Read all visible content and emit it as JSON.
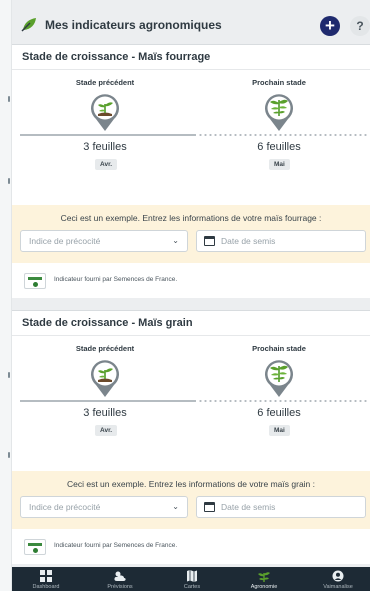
{
  "header": {
    "title": "Mes indicateurs agronomiques",
    "add_symbol": "+",
    "help_symbol": "?"
  },
  "colors": {
    "brand_green": "#5aa02c",
    "navy": "#1f2a6e",
    "example_band": "#fdf3dc",
    "nav_bg": "#1d2a35"
  },
  "cards": [
    {
      "title": "Stade de croissance - Maïs fourrage",
      "previous_label": "Stade précédent",
      "next_label": "Prochain stade",
      "previous_leaves": "3 feuilles",
      "next_leaves": "6 feuilles",
      "previous_month": "Avr.",
      "next_month": "Mai",
      "example_text": "Ceci est un exemple. Entrez les informations de votre maïs fourrage :",
      "precocity_placeholder": "Indice de précocité",
      "sowing_placeholder": "Date de semis",
      "provider_text": "Indicateur fourni par Semences de France."
    },
    {
      "title": "Stade de croissance - Maïs grain",
      "previous_label": "Stade précédent",
      "next_label": "Prochain stade",
      "previous_leaves": "3 feuilles",
      "next_leaves": "6 feuilles",
      "previous_month": "Avr.",
      "next_month": "Mai",
      "example_text": "Ceci est un exemple. Entrez les informations de votre maïs grain :",
      "precocity_placeholder": "Indice de précocité",
      "sowing_placeholder": "Date de semis",
      "provider_text": "Indicateur fourni par Semences de France."
    }
  ],
  "icons": {
    "brand": "leaf-icon",
    "stage": "corn-sprout-icon",
    "dropdown": "chevron-down-icon",
    "date": "calendar-icon",
    "provider": "semences-de-france-logo"
  },
  "nav": {
    "items": [
      {
        "label": "Dashboard",
        "icon": "dashboard-icon"
      },
      {
        "label": "Prévisions",
        "icon": "weather-icon"
      },
      {
        "label": "Cartes",
        "icon": "map-icon"
      },
      {
        "label": "Agronomie",
        "icon": "agronomy-icon",
        "active": true
      },
      {
        "label": "Vaimanalise",
        "icon": "profile-icon"
      }
    ]
  }
}
